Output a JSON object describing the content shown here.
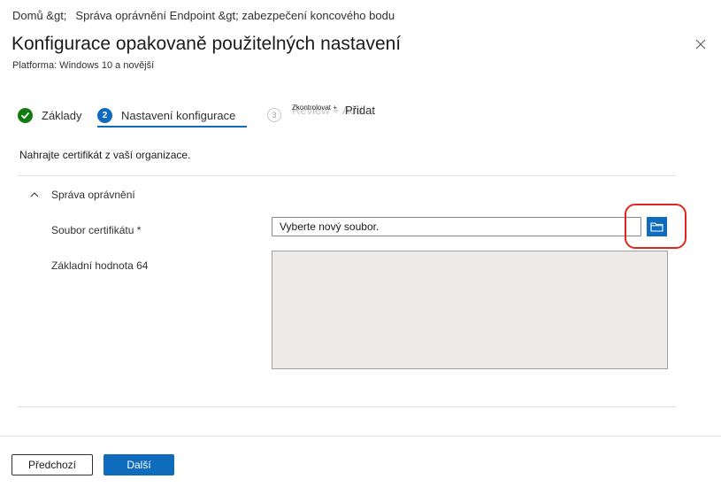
{
  "breadcrumb": {
    "home": "Domů &gt;",
    "path": "Správa oprávnění Endpoint &gt; zabezpečení koncového bodu"
  },
  "header": {
    "title": "Konfigurace opakovaně použitelných nastavení",
    "subtitle": "Platforma: Windows 10 a novější",
    "close_icon": "close-icon"
  },
  "steps": [
    {
      "number": "1",
      "label": "Základy",
      "status": "completed"
    },
    {
      "number": "2",
      "label": "Nastavení konfigurace",
      "status": "active"
    },
    {
      "number": "3",
      "label": "Review + Add",
      "overlay_label": "Zkontrolovat +",
      "overlay_add": "Přidat",
      "status": "pending"
    }
  ],
  "main": {
    "instruction": "Nahrajte certifikát z vaší organizace.",
    "section": {
      "title": "Správa oprávnění",
      "expanded": true
    },
    "fields": {
      "certificate_file": {
        "label": "Soubor certifikátu *",
        "value": "Vyberte nový soubor.",
        "browse_icon": "folder-icon"
      },
      "base64": {
        "label": "Základní hodnota 64",
        "value": ""
      }
    }
  },
  "footer": {
    "previous_label": "Předchozí",
    "next_label": "Další"
  },
  "colors": {
    "accent": "#0f6cbd",
    "success": "#107c10",
    "highlight": "#e1251b",
    "readonly_bg": "#edebe9"
  }
}
